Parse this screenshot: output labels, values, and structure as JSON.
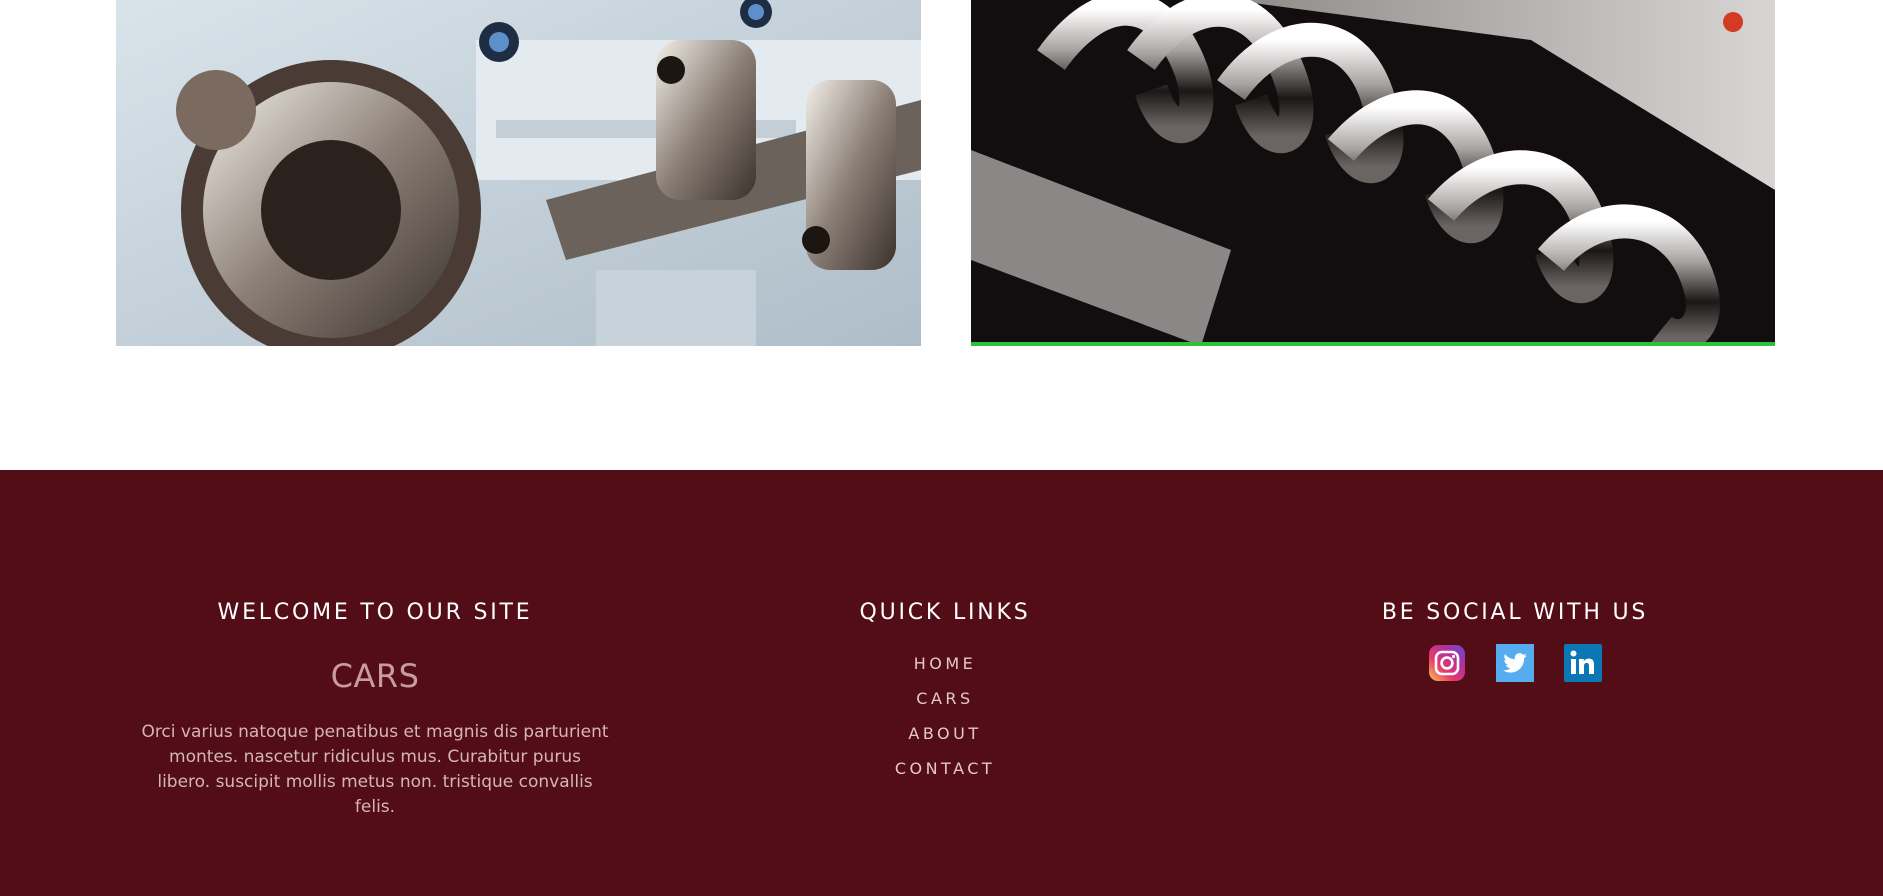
{
  "gallery": {
    "images": [
      {
        "alt": "Engine crankshaft and gears",
        "icon": "engine-gears-photo"
      },
      {
        "alt": "Chrome exhaust headers",
        "icon": "exhaust-headers-photo"
      }
    ]
  },
  "footer": {
    "background": "#520d16",
    "welcome": {
      "title": "WELCOME TO OUR SITE",
      "brand": "CARS",
      "text": "Orci varius natoque penatibus et magnis dis parturient montes. nascetur ridiculus mus. Curabitur purus libero. suscipit mollis metus non. tristique convallis felis."
    },
    "quick_links": {
      "title": "QUICK LINKS",
      "items": [
        {
          "label": "HOME"
        },
        {
          "label": "CARS"
        },
        {
          "label": "ABOUT"
        },
        {
          "label": "CONTACT"
        }
      ]
    },
    "social": {
      "title": "BE SOCIAL WITH US",
      "icons": [
        {
          "name": "instagram-icon"
        },
        {
          "name": "twitter-icon"
        },
        {
          "name": "linkedin-icon"
        }
      ]
    }
  }
}
